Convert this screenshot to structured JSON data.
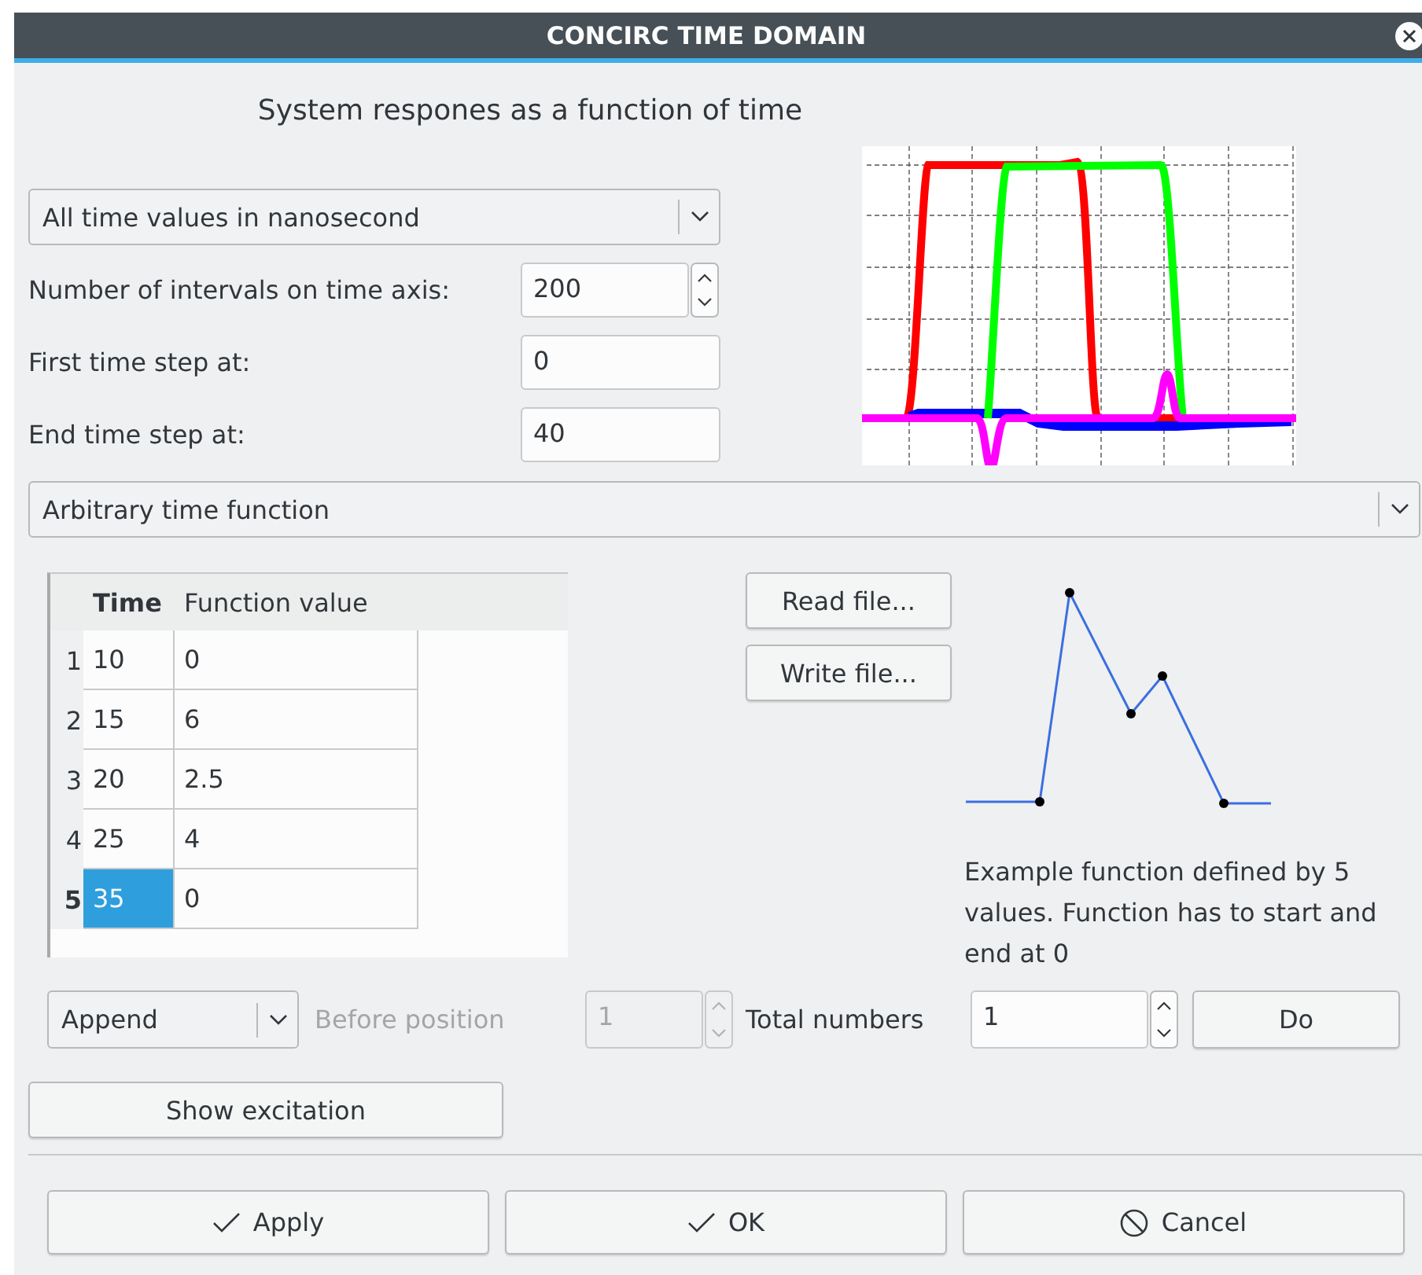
{
  "window": {
    "title": "CONCIRC TIME DOMAIN"
  },
  "heading": "System respones as a function of time",
  "time_unit": {
    "value": "All time values in nanosecond"
  },
  "fields": [
    {
      "label": "Number of intervals on time axis:",
      "value": "200",
      "kind": "spin"
    },
    {
      "label": "First time step at:",
      "value": "0",
      "kind": "text"
    },
    {
      "label": "End time step at:",
      "value": "40",
      "kind": "text"
    }
  ],
  "function_type": {
    "value": "Arbitrary time function"
  },
  "table": {
    "columns": [
      {
        "label": "Time",
        "selected": true
      },
      {
        "label": "Function value",
        "selected": false
      }
    ],
    "rows": [
      {
        "header": "1",
        "cells": [
          "10",
          "0"
        ],
        "selected": false
      },
      {
        "header": "2",
        "cells": [
          "15",
          "6"
        ],
        "selected": false
      },
      {
        "header": "3",
        "cells": [
          "20",
          "2.5"
        ],
        "selected": false
      },
      {
        "header": "4",
        "cells": [
          "25",
          "4"
        ],
        "selected": false
      },
      {
        "header": "5",
        "cells": [
          "35",
          "0"
        ],
        "selected": true
      }
    ]
  },
  "file_buttons": [
    "Read file...",
    "Write file..."
  ],
  "example": {
    "caption": "Example function defined by 5 values. Function has to start and end at 0"
  },
  "insert_row": {
    "mode": "Append",
    "before_label": "Before position",
    "before_value": "1",
    "disabled": true,
    "total_label": "Total numbers",
    "total_value": "1",
    "do_button": "Do"
  },
  "show_excitation": "Show excitation",
  "buttons": [
    {
      "label": "Apply",
      "kind": "check"
    },
    {
      "label": "OK",
      "kind": "check"
    },
    {
      "label": "Cancel",
      "kind": "cancel"
    }
  ]
}
